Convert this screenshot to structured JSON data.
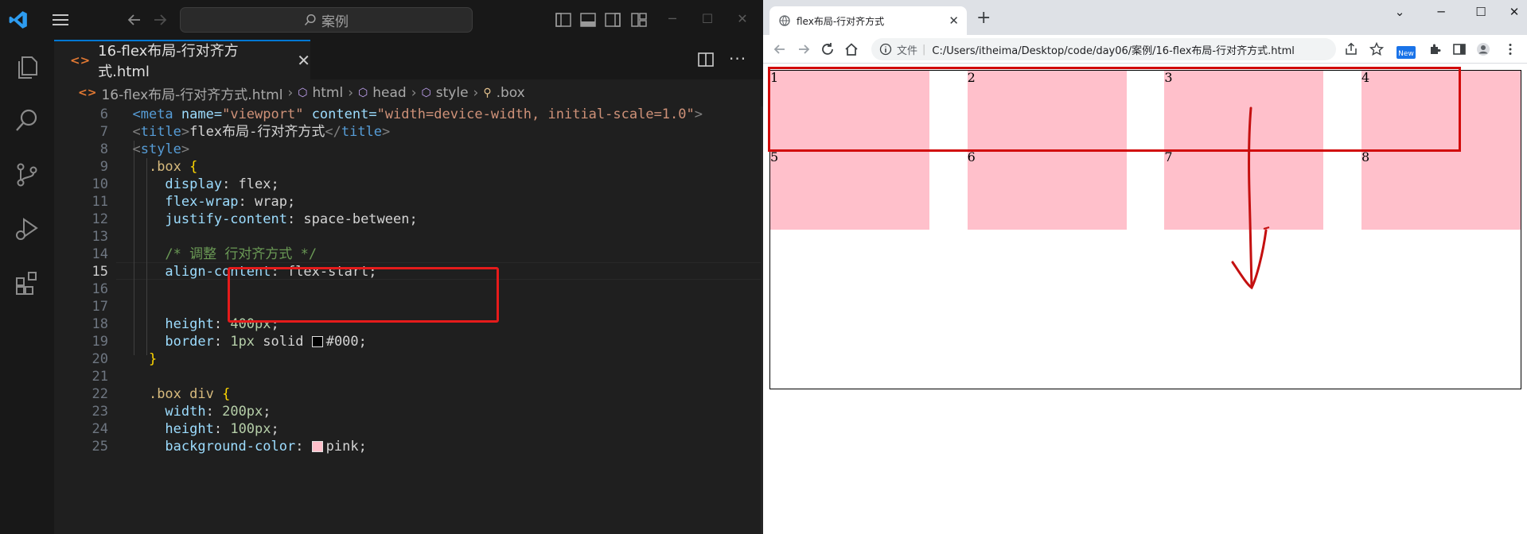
{
  "vscode": {
    "search_text": "案例",
    "tab_title": "16-flex布局-行对齐方式.html",
    "tab_icon": "<>",
    "tab_close": "✕",
    "more": "···",
    "breadcrumb": {
      "file": "16-flex布局-行对齐方式.html",
      "items": [
        "html",
        "head",
        "style",
        ".box"
      ]
    },
    "lines": [
      {
        "num": "6"
      },
      {
        "num": "7"
      },
      {
        "num": "8"
      },
      {
        "num": "9"
      },
      {
        "num": "10"
      },
      {
        "num": "11"
      },
      {
        "num": "12"
      },
      {
        "num": "13"
      },
      {
        "num": "14"
      },
      {
        "num": "15"
      },
      {
        "num": "16"
      },
      {
        "num": "17"
      },
      {
        "num": "18"
      },
      {
        "num": "19"
      },
      {
        "num": "20"
      },
      {
        "num": "21"
      },
      {
        "num": "22"
      },
      {
        "num": "23"
      },
      {
        "num": "24"
      },
      {
        "num": "25"
      }
    ],
    "active_line": "15",
    "code": {
      "l6_tag": "<meta",
      "l6_attr1": " name=",
      "l6_str1": "\"viewport\"",
      "l6_attr2": " content=",
      "l6_str2": "\"width=device-width, initial-scale=1.0\"",
      "l6_end": ">",
      "l7_open_lt": "<",
      "l7_open": "title",
      "l7_gt": ">",
      "l7_text": "flex布局-行对齐方式",
      "l7_close_lt": "</",
      "l7_close": "title",
      "l7_close_gt": ">",
      "l8_lt": "<",
      "l8_tag": "style",
      "l8_gt": ">",
      "l9_sel": ".box",
      "l9_brace": " {",
      "l10_prop": "display",
      "l10_val": ": flex;",
      "l11_prop": "flex-wrap",
      "l11_val": ": wrap;",
      "l12_prop": "justify-content",
      "l12_val": ": space-between;",
      "l14_cmt": "/* 调整 行对齐方式 */",
      "l15_prop": "align-content",
      "l15_val": ": flex-start;",
      "l18_prop": "height",
      "l18_sep": ": ",
      "l18_num": "400px",
      "l18_end": ";",
      "l19_prop": "border",
      "l19_sep": ": ",
      "l19_num": "1px",
      "l19_rest": " solid ",
      "l19_color": "#000;",
      "l20_brace": "}",
      "l22_sel": ".box div",
      "l22_brace": " {",
      "l23_prop": "width",
      "l23_sep": ": ",
      "l23_num": "200px",
      "l23_end": ";",
      "l24_prop": "height",
      "l24_sep": ": ",
      "l24_num": "100px",
      "l24_end": ";",
      "l25_prop": "background-color",
      "l25_sep": ": ",
      "l25_val": "pink;"
    }
  },
  "chrome": {
    "tab_title": "flex布局-行对齐方式",
    "tab_close": "✕",
    "new_tab": "+",
    "address_label": "文件",
    "address_sep": "|",
    "address": "C:/Users/itheima/Desktop/code/day06/案例/16-flex布局-行对齐方式.html",
    "new_badge": "New",
    "items": [
      "1",
      "2",
      "3",
      "4",
      "5",
      "6",
      "7",
      "8"
    ]
  },
  "colors": {
    "accent": "#0078d4",
    "annotation_red": "#e51b1b",
    "item_bg": "pink"
  }
}
